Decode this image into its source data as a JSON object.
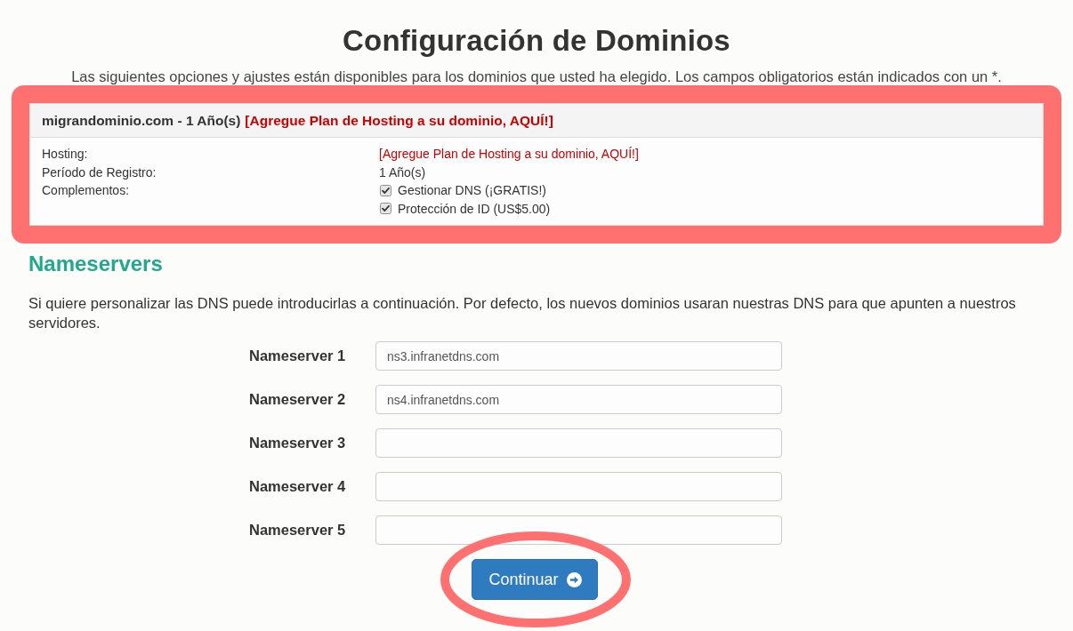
{
  "page": {
    "title": "Configuración de Dominios",
    "intro": "Las siguientes opciones y ajustes están disponibles para los dominios que usted ha elegido. Los campos obligatorios están indicados con un *."
  },
  "domain": {
    "highlighted": true,
    "name": "migrandominio.com - 1 Año(s)",
    "hosting_link": "[Agregue Plan de Hosting a su dominio, AQUÍ!]",
    "details": [
      {
        "kind": "link",
        "label": "Hosting:",
        "value": "[Agregue Plan de Hosting a su dominio, AQUÍ!]"
      },
      {
        "kind": "text",
        "label": "Período de Registro:",
        "value": "1 Año(s)"
      },
      {
        "kind": "checkboxes",
        "label": "Complementos:",
        "options": [
          {
            "label": "Gestionar DNS (¡GRATIS!)",
            "checked": true
          },
          {
            "label": "Protección de ID (US$5.00)",
            "checked": true
          }
        ]
      }
    ]
  },
  "nameservers": {
    "title": "Nameservers",
    "description": "Si quiere personalizar las DNS puede introducirlas a continuación. Por defecto, los nuevos dominios usaran nuestras DNS para que apunten a nuestros servidores.",
    "fields": [
      {
        "label": "Nameserver 1",
        "value": "ns3.infranetdns.com"
      },
      {
        "label": "Nameserver 2",
        "value": "ns4.infranetdns.com"
      },
      {
        "label": "Nameserver 3"
      },
      {
        "label": "Nameserver 4"
      },
      {
        "label": "Nameserver 5"
      }
    ]
  },
  "continue_button": {
    "label": "Continuar",
    "highlighted": true
  }
}
